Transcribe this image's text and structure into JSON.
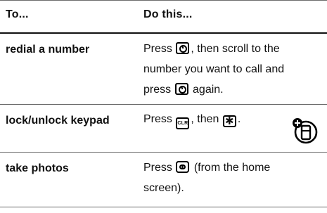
{
  "table": {
    "headers": [
      "To...",
      "Do this..."
    ],
    "rows": [
      {
        "action": "redial a number",
        "instruction": [
          "Press",
          ", then scroll to the number you want to call and press",
          "again."
        ],
        "key_icons": [
          "send-key-icon",
          "send-key-icon"
        ]
      },
      {
        "action": "lock/unlock keypad",
        "instruction": [
          "Press",
          ", then",
          "."
        ],
        "key_icons": [
          "clr-key-icon",
          "star-key-icon"
        ],
        "key_labels": [
          "CLR",
          "✱"
        ]
      },
      {
        "action": "take photos",
        "instruction": [
          "Press",
          "(from the home screen)."
        ],
        "key_icons": [
          "camera-key-icon"
        ]
      }
    ]
  },
  "margin_icon": "phone-feature-icon",
  "colors": {
    "text": "#111111",
    "rule_dark": "#111111",
    "rule_light": "#666666"
  }
}
